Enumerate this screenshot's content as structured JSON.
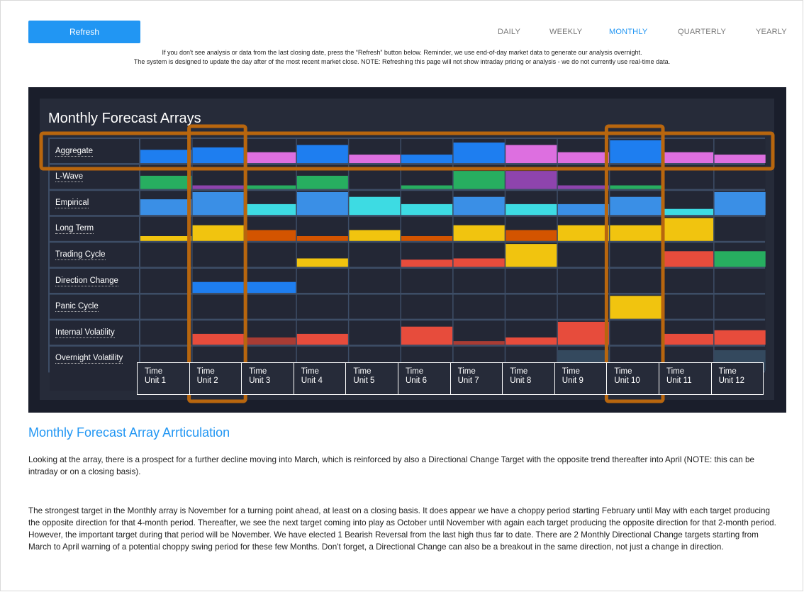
{
  "toolbar": {
    "refresh_label": "Refresh"
  },
  "tabs": [
    {
      "label": "DAILY",
      "active": false
    },
    {
      "label": "WEEKLY",
      "active": false
    },
    {
      "label": "MONTHLY",
      "active": true
    },
    {
      "label": "QUARTERLY",
      "active": false
    },
    {
      "label": "YEARLY",
      "active": false
    }
  ],
  "notice": {
    "line1": "If you don't see analysis or data from the last closing date, press the “Refresh” button below. Reminder, we use end-of-day market data to generate our analysis overnight.",
    "line2": "The system is designed to update the day after of the most recent market close. NOTE: Refreshing this page will not show intraday pricing or analysis - we do not currently use real-time data."
  },
  "panel": {
    "title": "Monthly Forecast Arrays"
  },
  "colors": {
    "blue": "#1e7ef0",
    "pink": "#dd6fe0",
    "green": "#27ae60",
    "purple": "#8e44ad",
    "lightblue": "#3a8fe6",
    "cyan": "#3ddbe3",
    "yellow": "#f1c40f",
    "orange": "#d35400",
    "red": "#e74c3c",
    "darkred": "#a93c34",
    "slate": "#34495e",
    "highlight": "#b8660e"
  },
  "array": {
    "rows": [
      {
        "label": "Aggregate",
        "cells": [
          {
            "c": "blue",
            "v": 0.55
          },
          {
            "c": "blue",
            "v": 0.65
          },
          {
            "c": "pink",
            "v": 0.45
          },
          {
            "c": "blue",
            "v": 0.75
          },
          {
            "c": "pink",
            "v": 0.35
          },
          {
            "c": "blue",
            "v": 0.35
          },
          {
            "c": "blue",
            "v": 0.85
          },
          {
            "c": "pink",
            "v": 0.75
          },
          {
            "c": "pink",
            "v": 0.45
          },
          {
            "c": "blue",
            "v": 0.95
          },
          {
            "c": "pink",
            "v": 0.45
          },
          {
            "c": "pink",
            "v": 0.35
          }
        ]
      },
      {
        "label": "L-Wave",
        "cells": [
          {
            "c": "green",
            "v": 0.55
          },
          {
            "c": "purple",
            "v": 0.15
          },
          {
            "c": "green",
            "v": 0.15
          },
          {
            "c": "green",
            "v": 0.55
          },
          null,
          {
            "c": "green",
            "v": 0.15
          },
          {
            "c": "green",
            "v": 0.75
          },
          {
            "c": "purple",
            "v": 0.75
          },
          {
            "c": "purple",
            "v": 0.15
          },
          {
            "c": "green",
            "v": 0.15
          },
          null,
          null
        ]
      },
      {
        "label": "Empirical",
        "cells": [
          {
            "c": "lightblue",
            "v": 0.65
          },
          {
            "c": "lightblue",
            "v": 0.95
          },
          {
            "c": "cyan",
            "v": 0.45
          },
          {
            "c": "lightblue",
            "v": 0.95
          },
          {
            "c": "cyan",
            "v": 0.75
          },
          {
            "c": "cyan",
            "v": 0.45
          },
          {
            "c": "lightblue",
            "v": 0.75
          },
          {
            "c": "cyan",
            "v": 0.45
          },
          {
            "c": "lightblue",
            "v": 0.45
          },
          {
            "c": "lightblue",
            "v": 0.75
          },
          {
            "c": "cyan",
            "v": 0.25
          },
          {
            "c": "lightblue",
            "v": 0.95
          }
        ]
      },
      {
        "label": "Long Term",
        "cells": [
          {
            "c": "yellow",
            "v": 0.2
          },
          {
            "c": "yellow",
            "v": 0.65
          },
          {
            "c": "orange",
            "v": 0.45
          },
          {
            "c": "orange",
            "v": 0.2
          },
          {
            "c": "yellow",
            "v": 0.45
          },
          {
            "c": "orange",
            "v": 0.2
          },
          {
            "c": "yellow",
            "v": 0.65
          },
          {
            "c": "orange",
            "v": 0.45
          },
          {
            "c": "yellow",
            "v": 0.65
          },
          {
            "c": "yellow",
            "v": 0.65
          },
          {
            "c": "yellow",
            "v": 0.95
          },
          null
        ]
      },
      {
        "label": "Trading Cycle",
        "cells": [
          null,
          null,
          null,
          {
            "c": "yellow",
            "v": 0.35
          },
          null,
          {
            "c": "red",
            "v": 0.3
          },
          {
            "c": "red",
            "v": 0.35
          },
          {
            "c": "yellow",
            "v": 0.95
          },
          null,
          null,
          {
            "c": "red",
            "v": 0.65
          },
          {
            "c": "green",
            "v": 0.65
          }
        ]
      },
      {
        "label": "Direction Change",
        "cells": [
          null,
          {
            "c": "blue",
            "v": 0.45
          },
          {
            "c": "blue",
            "v": 0.45
          },
          null,
          null,
          null,
          null,
          null,
          null,
          null,
          null,
          null
        ]
      },
      {
        "label": "Panic Cycle",
        "cells": [
          null,
          null,
          null,
          null,
          null,
          null,
          null,
          null,
          null,
          {
            "c": "yellow",
            "v": 0.95
          },
          null,
          null
        ]
      },
      {
        "label": "Internal Volatility",
        "cells": [
          null,
          {
            "c": "red",
            "v": 0.45
          },
          {
            "c": "darkred",
            "v": 0.3
          },
          {
            "c": "red",
            "v": 0.45
          },
          null,
          {
            "c": "red",
            "v": 0.75
          },
          {
            "c": "darkred",
            "v": 0.15
          },
          {
            "c": "red",
            "v": 0.3
          },
          {
            "c": "red",
            "v": 0.95
          },
          null,
          {
            "c": "red",
            "v": 0.45
          },
          {
            "c": "red",
            "v": 0.6
          }
        ]
      },
      {
        "label": "Overnight Volatility",
        "cells": [
          null,
          null,
          null,
          {
            "c": "slate",
            "v": 0.3
          },
          null,
          {
            "c": "slate",
            "v": 0.3
          },
          null,
          null,
          {
            "c": "slate",
            "v": 0.85
          },
          null,
          {
            "c": "slate",
            "v": 0.3
          },
          {
            "c": "slate",
            "v": 0.85
          }
        ]
      }
    ],
    "time_units": [
      "Time Unit 1",
      "Time Unit 2",
      "Time Unit 3",
      "Time Unit 4",
      "Time Unit 5",
      "Time Unit 6",
      "Time Unit 7",
      "Time Unit 8",
      "Time Unit 9",
      "Time Unit 10",
      "Time Unit 11",
      "Time Unit 12"
    ],
    "highlighted_columns": [
      2,
      10
    ]
  },
  "article": {
    "title": "Monthly Forecast Array Arrticulation",
    "paragraphs": [
      "Looking at the array, there is a prospect for a further decline moving into March, which is reinforced by also a Directional Change Target with the opposite trend thereafter into April (NOTE: this can be intraday or on a closing basis).",
      "The strongest target in the Monthly array is November for a turning point ahead, at least on a closing basis. It does appear we have a choppy period starting February until May with each target producing the opposite direction for that 4-month period. Thereafter, we see the next target coming into play as October until November with again each target producing the opposite direction for that 2-month period. However, the important target during that period will be November. We have elected 1 Bearish Reversal from the last high thus far to date. There are 2 Monthly Directional Change targets starting from March to April warning of a potential choppy swing period for these few Months. Don't forget, a Directional Change can also be a breakout in the same direction, not just a change in direction."
    ]
  }
}
